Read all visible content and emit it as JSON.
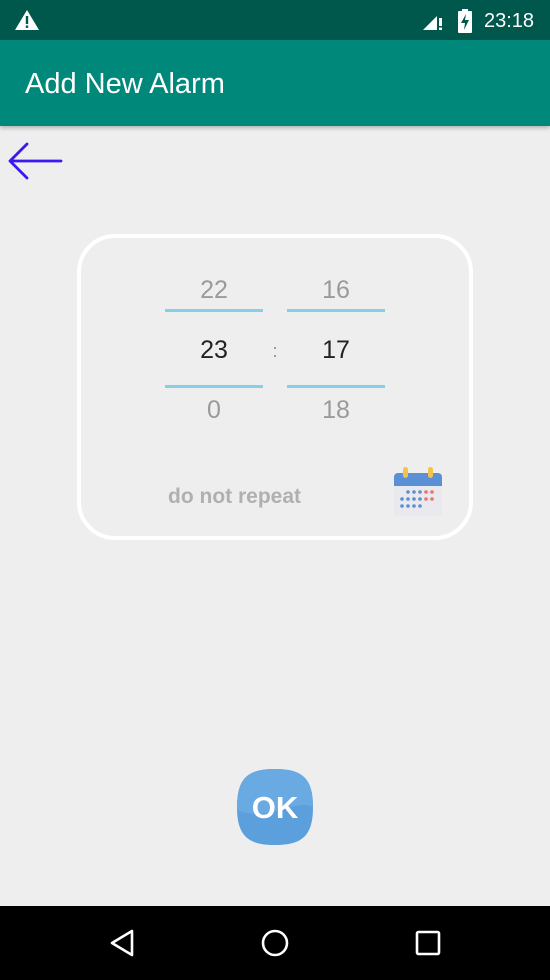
{
  "status_bar": {
    "time": "23:18",
    "icons": [
      "warning-icon",
      "signal-icon",
      "battery-charging-icon"
    ]
  },
  "app_bar": {
    "title": "Add New Alarm"
  },
  "back_button": {
    "icon": "arrow-left-icon",
    "color": "#3d17f0"
  },
  "time_picker": {
    "hour": {
      "above": "22",
      "selected": "23",
      "below": "0"
    },
    "separator": ":",
    "minute": {
      "above": "16",
      "selected": "17",
      "below": "18"
    },
    "divider_color": "#87ceeb"
  },
  "repeat": {
    "label": "do not repeat",
    "icon": "calendar-icon"
  },
  "ok_button": {
    "label": "OK",
    "color": "#5b9fdc"
  },
  "nav_bar": {
    "icons": [
      "back-triangle-icon",
      "home-circle-icon",
      "recents-square-icon"
    ]
  },
  "colors": {
    "status_bar": "#00574b",
    "app_bar": "#00897b",
    "background": "#eeeeee"
  }
}
